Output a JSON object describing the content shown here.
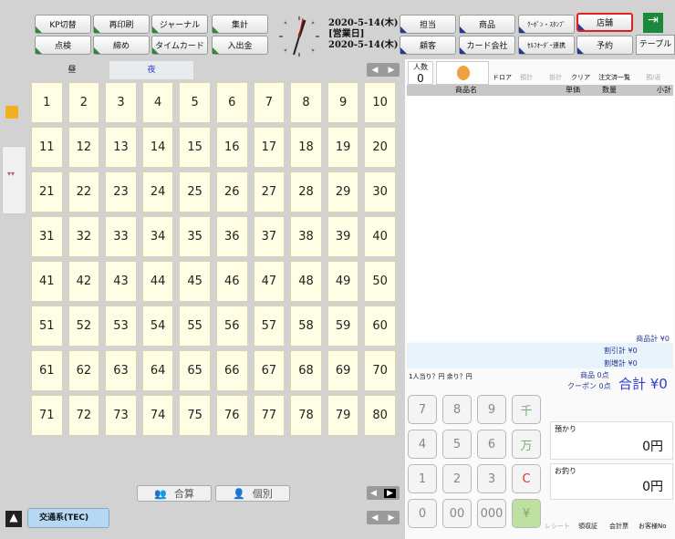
{
  "toolbar": {
    "row1": [
      "KP切替",
      "再印刷",
      "ジャーナル",
      "集計"
    ],
    "row2": [
      "点検",
      "締め",
      "タイムカード",
      "入出金"
    ]
  },
  "datetime": {
    "date1": "2020-5-14(木)",
    "business_label": "[営業日]",
    "date2": "2020-5-14(木)"
  },
  "right_buttons": {
    "row1": [
      "担当",
      "商品",
      "ｸｰﾎﾟﾝ・ｽﾀﾝﾌﾟ",
      "店舗"
    ],
    "row2": [
      "顧客",
      "カード会社",
      "ｾﾙﾌｵｰﾀﾞｰ連携",
      "予約"
    ]
  },
  "table_tab": "テーブル",
  "tabs": {
    "day": "昼",
    "night": "夜"
  },
  "tables": [
    "1",
    "2",
    "3",
    "4",
    "5",
    "6",
    "7",
    "8",
    "9",
    "10",
    "11",
    "12",
    "13",
    "14",
    "15",
    "16",
    "17",
    "18",
    "19",
    "20",
    "21",
    "22",
    "23",
    "24",
    "25",
    "26",
    "27",
    "28",
    "29",
    "30",
    "31",
    "32",
    "33",
    "34",
    "35",
    "36",
    "37",
    "38",
    "39",
    "40",
    "41",
    "42",
    "43",
    "44",
    "45",
    "46",
    "47",
    "48",
    "49",
    "50",
    "51",
    "52",
    "53",
    "54",
    "55",
    "56",
    "57",
    "58",
    "59",
    "60",
    "61",
    "62",
    "63",
    "64",
    "65",
    "66",
    "67",
    "68",
    "69",
    "70",
    "71",
    "72",
    "73",
    "74",
    "75",
    "76",
    "77",
    "78",
    "79",
    "80"
  ],
  "bottom": {
    "settle": "合算",
    "individual": "個別",
    "transit": "交通系(TEC)"
  },
  "order": {
    "people_label": "人数",
    "people": "0",
    "icons": [
      "ドロア",
      "預計",
      "掛計",
      "クリア",
      "注文済一覧",
      "預/返"
    ],
    "cols": [
      "商品名",
      "単価",
      "数量",
      "小計"
    ]
  },
  "totals": {
    "goods": "商品計 ¥0",
    "discount": "割引計 ¥0",
    "surcharge": "割増計 ¥0",
    "per_person": "1人当り？円 余り？円",
    "pts_goods": "商品 0点",
    "pts_coupon": "クーポン 0点",
    "total": "合計 ¥0"
  },
  "keypad": [
    "7",
    "8",
    "9",
    "千",
    "4",
    "5",
    "6",
    "万",
    "1",
    "2",
    "3",
    "C",
    "0",
    "00",
    "000",
    "¥"
  ],
  "pay": {
    "deposit_label": "預かり",
    "deposit": "0円",
    "change_label": "お釣り",
    "change": "0円"
  },
  "bottom_icons": [
    "レシート",
    "領収証",
    "会計票",
    "お客様No"
  ]
}
